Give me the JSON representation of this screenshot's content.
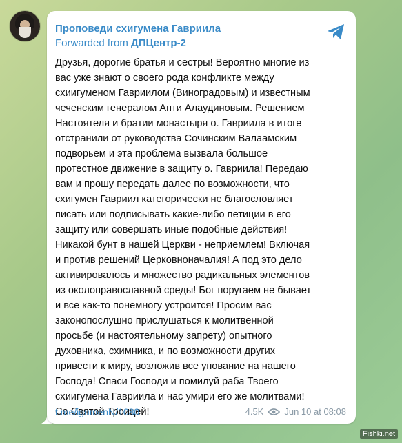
{
  "post": {
    "channel_name": "Проповеди схигумена Гавриила",
    "forwarded_prefix": "Forwarded from ",
    "forwarded_source": "ДПЦентр-2",
    "lines": [
      "Друзья, дорогие братья и сестры! Вероятно многие из",
      "вас уже знают о своего рода конфликте между",
      "схиигуменом Гавриилом (Виноградовым) и известным",
      "чеченским генералом Апти Алаудиновым. Решением",
      "Настоятеля и братии монастыря о. Гавриила в итоге",
      "отстранили от руководства Сочинским Валаамским",
      "подворьем и эта проблема вызвала большое",
      "протестное движение в защиту о. Гавриила! Передаю",
      "вам и прошу передать далее по возможности, что",
      "схигумен Гавриил категорически не благословляет",
      "писать или подписывать какие-либо петиции в его",
      "защиту или совершать иные подобные действия!",
      "Никакой бунт в нашей Церкви - неприемлем! Включая",
      "и против решений Церковноначалия! А под это дело",
      "активировалось и множество радикальных элементов",
      "из околоправославной среды! Бог поругаем не бывает",
      "и все как-то понемногу устроится! Просим вас",
      "законопослушно прислушаться к молитвенной",
      "просьбе (и настоятельному запрету) опытного",
      "духовника, схимника, и по возможности других",
      "привести к миру, возложив все упование на нашего",
      "Господа! Спаси Господи и помилуй раба Твоего",
      "схиигумена Гавриила и нас умири его же молитвами!",
      "Со Святой Троицей!"
    ],
    "link": "t.me/igumenN/1080",
    "views": "4.5K",
    "date": "Jun 10 at 08:08"
  },
  "icons": {
    "share": "telegram-share-icon",
    "views": "eye-icon"
  },
  "colors": {
    "accent": "#3a8bc8",
    "background": "#a8c98a",
    "card": "#ffffff",
    "meta": "#8a9aa6"
  },
  "watermark": "Fishki.net"
}
